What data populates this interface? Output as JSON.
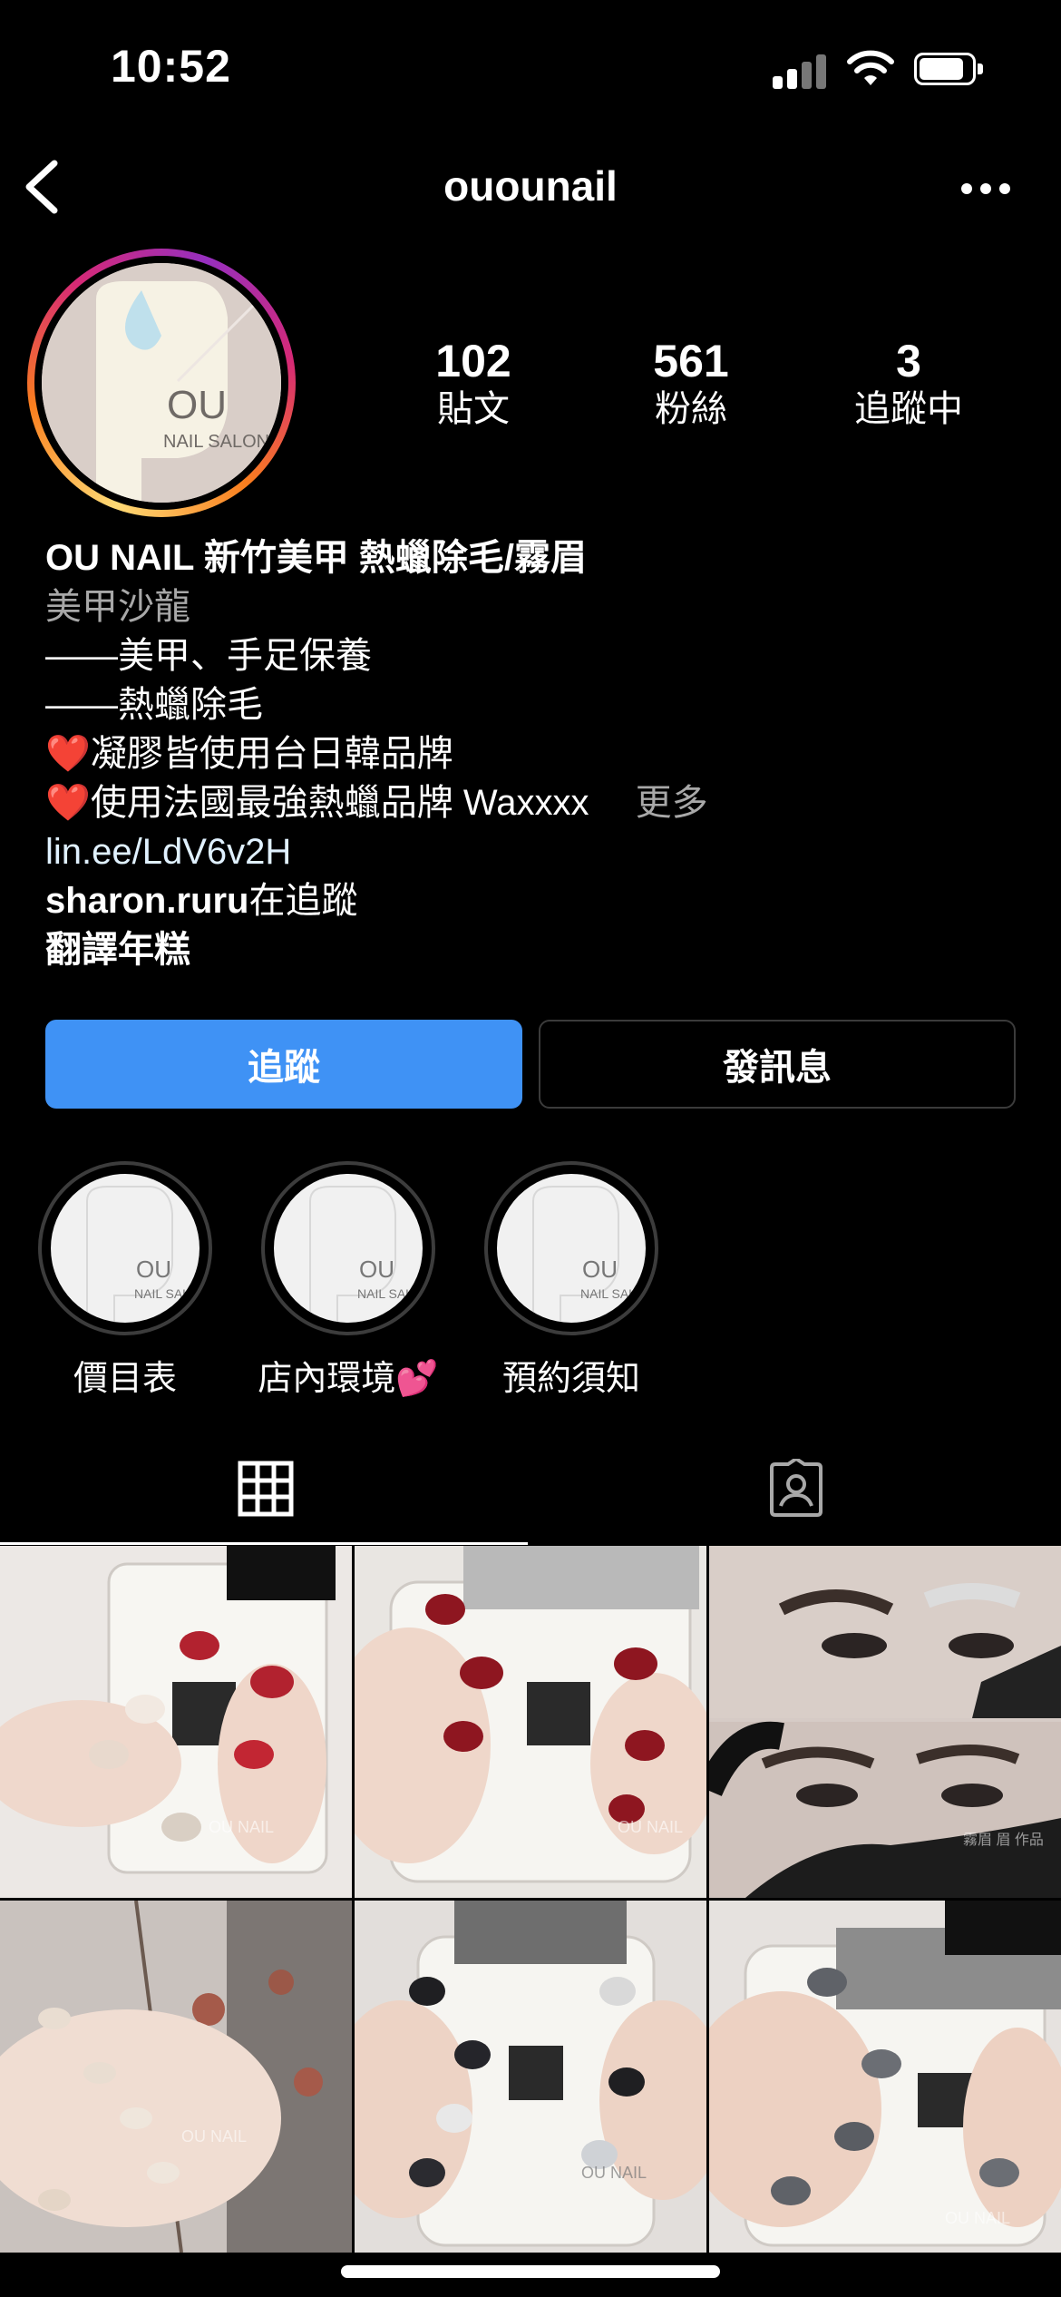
{
  "status_bar": {
    "time": "10:52"
  },
  "header": {
    "username": "ouounail"
  },
  "avatar": {
    "logo_text_1": "OU",
    "logo_text_2": "NAIL SALON"
  },
  "stats": [
    {
      "value": "102",
      "label": "貼文"
    },
    {
      "value": "561",
      "label": "粉絲"
    },
    {
      "value": "3",
      "label": "追蹤中"
    }
  ],
  "bio": {
    "name": "OU NAIL 新竹美甲 熱蠟除毛/霧眉",
    "category": "美甲沙龍",
    "lines": [
      "——美甲、手足保養",
      "——熱蠟除毛",
      "凝膠皆使用台日韓品牌",
      "使用法國最強熱蠟品牌 Waxxxx"
    ],
    "more_label": "更多",
    "heart_glyph": "❤️",
    "link": "lin.ee/LdV6v2H",
    "followed_by_user": "sharon.ruru",
    "followed_by_suffix": "在追蹤",
    "translate_label": "翻譯年糕"
  },
  "buttons": {
    "follow": "追蹤",
    "message": "發訊息"
  },
  "highlights": [
    {
      "label": "價目表"
    },
    {
      "label": "店內環境💕"
    },
    {
      "label": "預約須知"
    }
  ],
  "highlight_logo": {
    "text_1": "OU",
    "text_2": "NAIL SALON"
  },
  "colors": {
    "follow_button": "#3f92f5",
    "background": "#000000",
    "secondary_text": "#a8a8a8"
  },
  "grid_posts": [
    {
      "watermark": "OU NAIL"
    },
    {
      "watermark": "OU NAIL"
    },
    {
      "watermark": "霧眉 眉 作品"
    },
    {
      "watermark": "OU NAIL"
    },
    {
      "watermark": "OU NAIL"
    },
    {
      "watermark": "OU NAIL"
    }
  ]
}
